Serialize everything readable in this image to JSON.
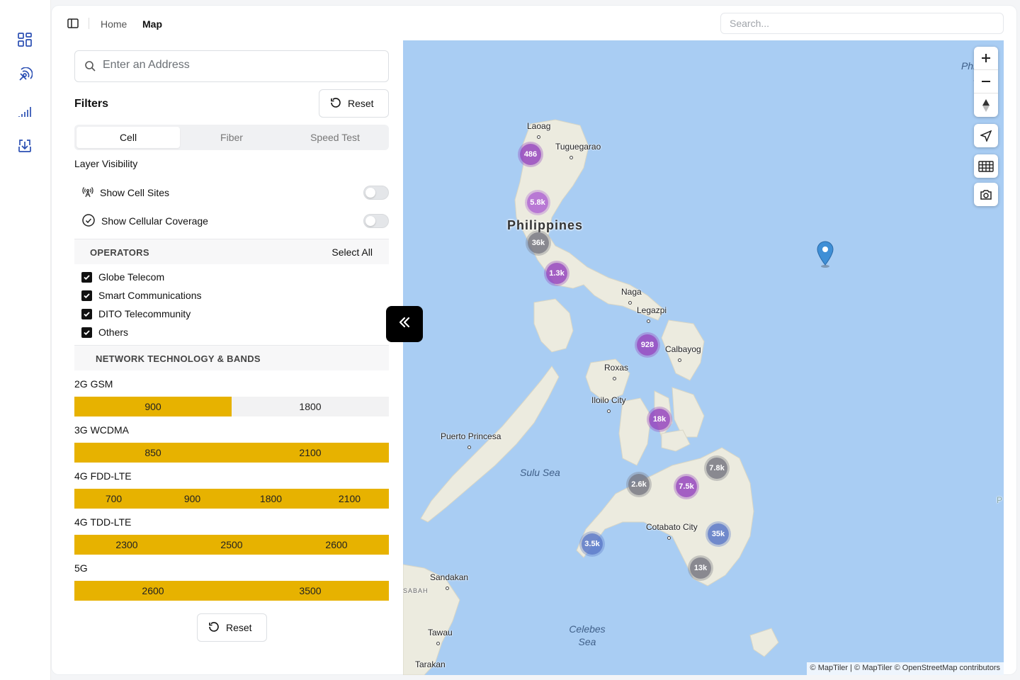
{
  "rail": {
    "icons": [
      "dashboard-icon",
      "signal-tower-icon",
      "signal-bars-icon",
      "download-icon"
    ]
  },
  "breadcrumb": {
    "home": "Home",
    "current": "Map"
  },
  "top_search": {
    "placeholder": "Search..."
  },
  "filters": {
    "address_placeholder": "Enter an Address",
    "title": "Filters",
    "reset_label": "Reset",
    "tabs": [
      {
        "label": "Cell",
        "active": true
      },
      {
        "label": "Fiber",
        "active": false
      },
      {
        "label": "Speed Test",
        "active": false
      }
    ],
    "layer_visibility": {
      "title": "Layer Visibility",
      "show_cell_sites": {
        "label": "Show Cell Sites",
        "on": false
      },
      "show_cellular_coverage": {
        "label": "Show Cellular Coverage",
        "on": false
      }
    },
    "operators": {
      "title": "OPERATORS",
      "select_all": "Select All",
      "items": [
        {
          "label": "Globe Telecom",
          "checked": true
        },
        {
          "label": "Smart Communications",
          "checked": true
        },
        {
          "label": "DITO Telecommunity",
          "checked": true
        },
        {
          "label": "Others",
          "checked": true
        }
      ]
    },
    "network": {
      "title": "NETWORK TECHNOLOGY & BANDS",
      "tech": [
        {
          "label": "2G GSM",
          "bands": [
            {
              "label": "900",
              "on": true
            },
            {
              "label": "1800",
              "on": false
            }
          ]
        },
        {
          "label": "3G WCDMA",
          "bands": [
            {
              "label": "850",
              "on": true
            },
            {
              "label": "2100",
              "on": true
            }
          ]
        },
        {
          "label": "4G FDD-LTE",
          "bands": [
            {
              "label": "700",
              "on": true
            },
            {
              "label": "900",
              "on": true
            },
            {
              "label": "1800",
              "on": true
            },
            {
              "label": "2100",
              "on": true
            }
          ]
        },
        {
          "label": "4G TDD-LTE",
          "bands": [
            {
              "label": "2300",
              "on": true
            },
            {
              "label": "2500",
              "on": true
            },
            {
              "label": "2600",
              "on": true
            }
          ]
        },
        {
          "label": "5G",
          "bands": [
            {
              "label": "2600",
              "on": true
            },
            {
              "label": "3500",
              "on": true
            }
          ]
        }
      ]
    },
    "bottom_reset_label": "Reset"
  },
  "map": {
    "country_label": "Philippines",
    "places": [
      "Laoag",
      "Tuguegarao",
      "Naga",
      "Legazpi",
      "Calbayog",
      "Roxas",
      "Iloilo City",
      "Puerto Princesa",
      "Cotabato City",
      "Sandakan",
      "Tawau",
      "Tarakan"
    ],
    "seas": [
      "Sulu Sea",
      "Celebes Sea",
      "Philipp Sea"
    ],
    "small_labels": [
      "SABAH",
      "P"
    ],
    "clusters": [
      "486",
      "5.8k",
      "36k",
      "1.3k",
      "928",
      "18k",
      "2.6k",
      "7.5k",
      "7.8k",
      "3.5k",
      "35k",
      "13k"
    ],
    "controls": [
      "zoom-in",
      "zoom-out",
      "compass",
      "locate",
      "grid",
      "screenshot"
    ],
    "attribution": "© MapTiler | © MapTiler © OpenStreetMap contributors"
  },
  "colors": {
    "band_on": "#e7b200",
    "band_off": "#f2f2f3",
    "sea": "#a9cdf3",
    "land": "#ecebe0"
  }
}
